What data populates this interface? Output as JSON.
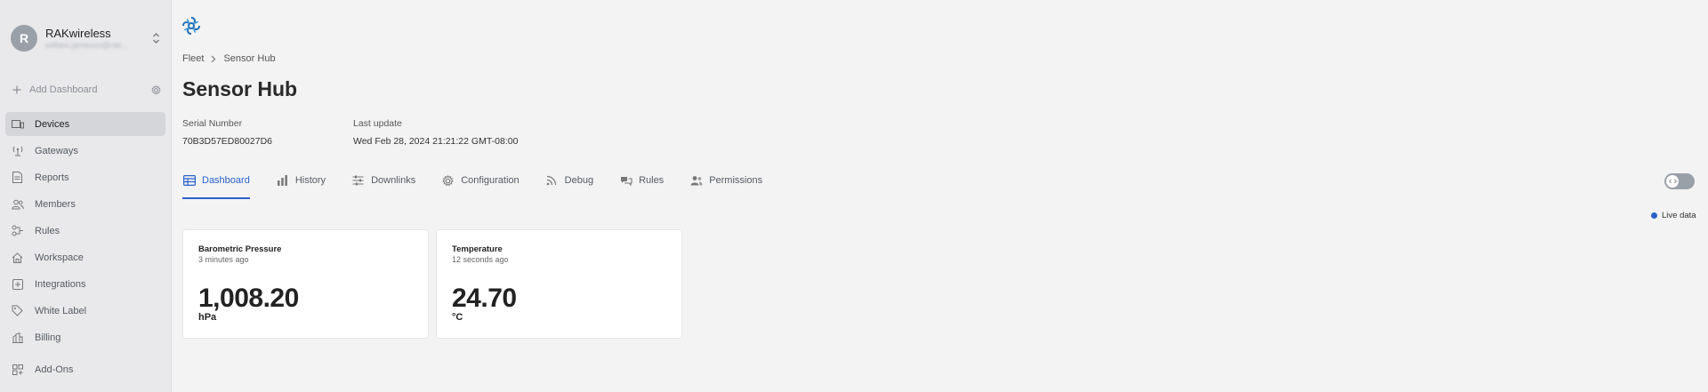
{
  "org": {
    "initial": "R",
    "name": "RAKwireless",
    "subtitle": "william.jameson@rak..."
  },
  "sidebar": {
    "add_dashboard": "Add Dashboard",
    "items": [
      {
        "label": "Devices",
        "icon": "devices-icon",
        "active": true
      },
      {
        "label": "Gateways",
        "icon": "gateway-icon"
      },
      {
        "label": "Reports",
        "icon": "report-icon"
      },
      {
        "label": "Members",
        "icon": "members-icon"
      },
      {
        "label": "Rules",
        "icon": "rules-icon"
      },
      {
        "label": "Workspace",
        "icon": "home-icon"
      },
      {
        "label": "Integrations",
        "icon": "integrations-icon"
      },
      {
        "label": "White Label",
        "icon": "tag-icon"
      },
      {
        "label": "Billing",
        "icon": "billing-icon"
      },
      {
        "label": "Add-Ons",
        "icon": "addons-icon"
      }
    ]
  },
  "breadcrumb": {
    "parent": "Fleet",
    "current": "Sensor Hub"
  },
  "page": {
    "title": "Sensor Hub",
    "serial_label": "Serial Number",
    "serial_value": "70B3D57ED80027D6",
    "update_label": "Last update",
    "update_value": "Wed Feb 28, 2024 21:21:22 GMT-08:00"
  },
  "tabs": [
    {
      "label": "Dashboard",
      "icon": "table-icon",
      "active": true
    },
    {
      "label": "History",
      "icon": "bar-chart-icon"
    },
    {
      "label": "Downlinks",
      "icon": "sliders-icon"
    },
    {
      "label": "Configuration",
      "icon": "gear-icon"
    },
    {
      "label": "Debug",
      "icon": "rss-icon"
    },
    {
      "label": "Rules",
      "icon": "rules-icon"
    },
    {
      "label": "Permissions",
      "icon": "users-icon"
    }
  ],
  "live_label": "Live data",
  "cards": [
    {
      "title": "Barometric Pressure",
      "time": "3 minutes ago",
      "value": "1,008.20",
      "unit": "hPa"
    },
    {
      "title": "Temperature",
      "time": "12 seconds ago",
      "value": "24.70",
      "unit": "°C"
    }
  ],
  "colors": {
    "accent": "#2a62c9",
    "sidebar_bg": "#e9e9ec",
    "page_bg": "#f3f3f4"
  }
}
